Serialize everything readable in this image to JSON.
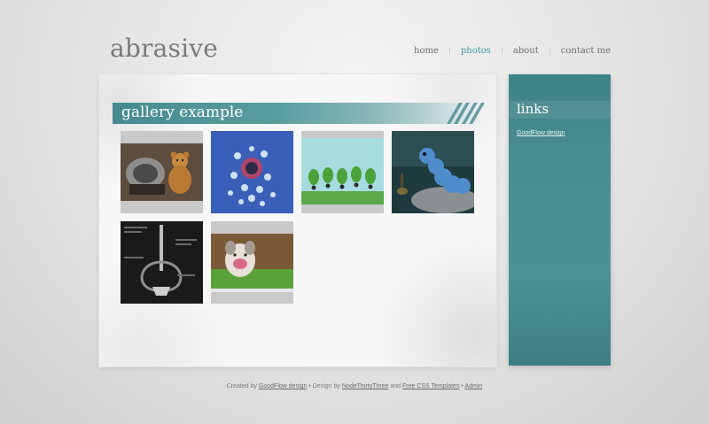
{
  "header": {
    "logo": "abrasive",
    "nav": [
      {
        "label": "home",
        "active": false
      },
      {
        "label": "photos",
        "active": true
      },
      {
        "label": "about",
        "active": false
      },
      {
        "label": "contact me",
        "active": false
      }
    ]
  },
  "main": {
    "title": "gallery example"
  },
  "sidebar": {
    "title": "links",
    "link_label": "GoodFlow design"
  },
  "footer": {
    "prefix": "Created by",
    "link1": "GoodFlow design",
    "sep1": "•",
    "design_by": "Design by",
    "link2": "NodeThirtyThree",
    "and": "and",
    "link3": "Free CSS Templates",
    "sep2": "•",
    "link4": "Admin"
  },
  "colors": {
    "accent": "#3c9aa8",
    "teal_panel": "#4a8e91",
    "gallery_bar": "#468a8f"
  }
}
